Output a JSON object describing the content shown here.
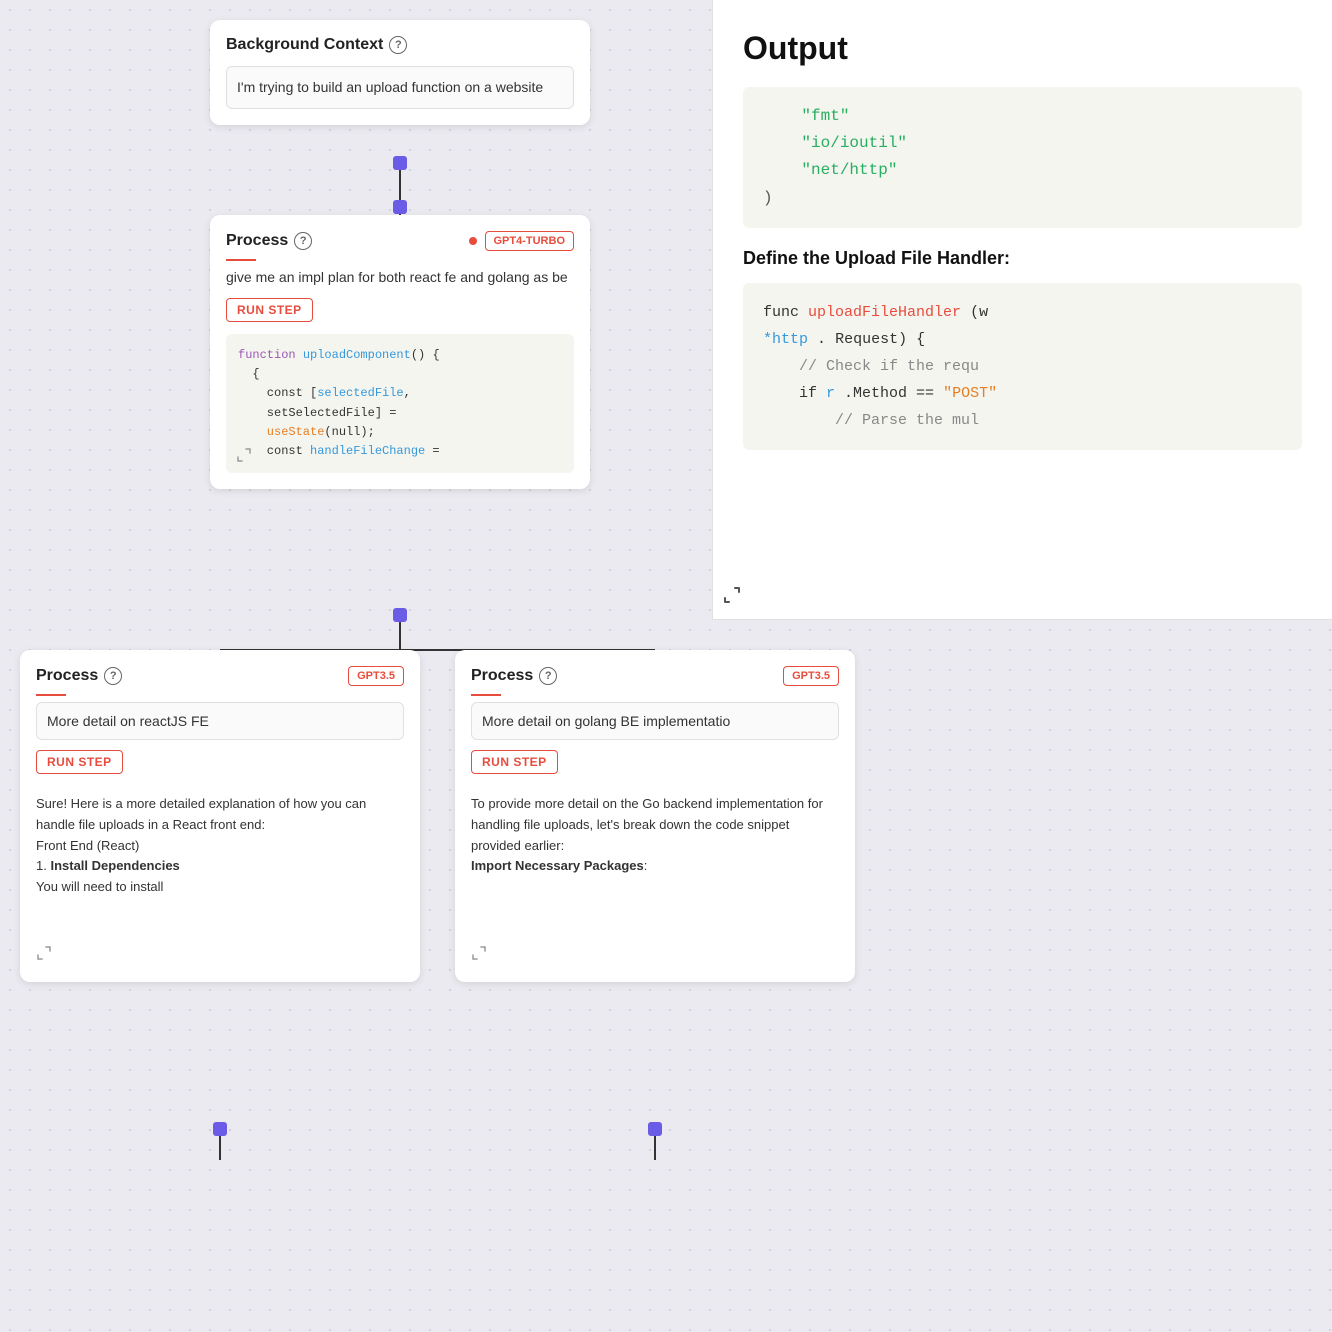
{
  "background_context": {
    "title": "Background Context",
    "body_text": "I'm trying to build an upload function on a website"
  },
  "process_top": {
    "title": "Process",
    "gpt_label": "GPT4-TURBO",
    "prompt_text": "give me an impl plan for both react fe and golang as be",
    "run_step_label": "RUN STEP",
    "code_lines": [
      "function uploadComponent() {",
      "  {",
      "    const [selectedFile,",
      "    setSelectedFile] =",
      "    useState(null);",
      "    const handleFileChange ="
    ]
  },
  "process_bl": {
    "title": "Process",
    "gpt_label": "GPT3.5",
    "input_text": "More detail on reactJS FE",
    "run_step_label": "RUN STEP",
    "output_text": "Sure! Here is a more detailed explanation of how you can handle file uploads in a React front end:\nFront End (React)\n1. Install Dependencies\nYou will need to install"
  },
  "process_br": {
    "title": "Process",
    "gpt_label": "GPT3.5",
    "input_text": "More detail on golang BE implementatio",
    "run_step_label": "RUN STEP",
    "output_text": "To provide more detail on the Go backend implementation for handling file uploads, let's break down the code snippet provided earlier:\nImport Necessary Packages:"
  },
  "output_panel": {
    "title": "Output",
    "code_section1": {
      "lines": [
        {
          "text": "\"fmt\"",
          "color": "green"
        },
        {
          "text": "\"io/ioutil\"",
          "color": "green"
        },
        {
          "text": "\"net/http\"",
          "color": "green"
        },
        {
          "text": ")",
          "color": "dark"
        }
      ]
    },
    "section2_title": "Define the Upload File Handler:",
    "code_section2": {
      "lines": [
        {
          "text": "func uploadFileHandler(w",
          "colors": [
            "dark",
            "dark",
            "red",
            "dark"
          ]
        },
        {
          "text": "*http.Request) {",
          "colors": [
            "blue",
            "dark",
            "dark"
          ]
        },
        {
          "text": "// Check if the requ",
          "color": "gray"
        },
        {
          "text": "if r.Method == \"POST\"",
          "colors": [
            "dark",
            "blue",
            "dark",
            "orange",
            "dark"
          ]
        },
        {
          "text": "// Parse the mul",
          "color": "gray"
        }
      ]
    }
  },
  "icons": {
    "help": "?",
    "expand": "⤡",
    "resize": "⤡"
  }
}
